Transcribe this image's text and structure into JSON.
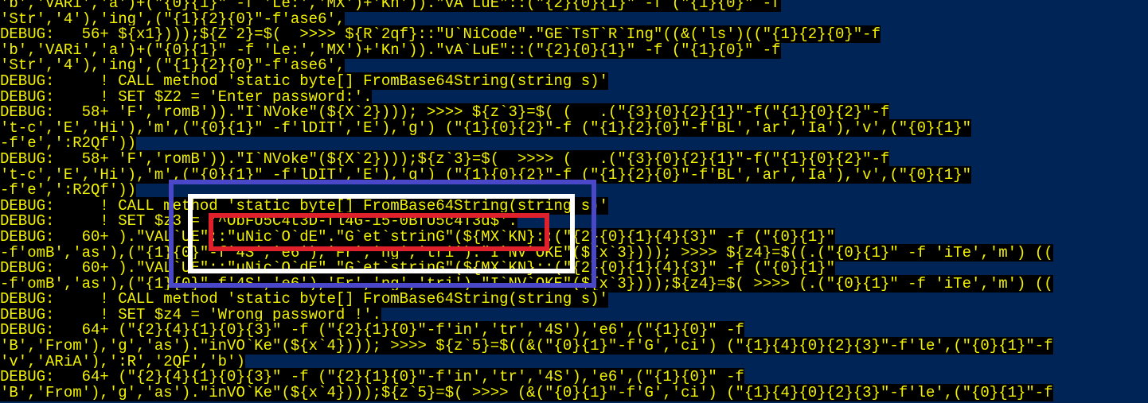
{
  "console": {
    "lines": [
      "'b','VARi','a')+(\"{0}{1}\" -f 'Le:','MX')+'Kn')).\"vA`LuE\"::(\"{2}{0}{1}\" -f (\"{1}{0}\" -f",
      "'Str','4'),'ing',(\"{1}{2}{0}\"-f'ase6',",
      "DEBUG:   56+ ${x1})));${Z`2}=$(  >>>> ${R`2qf}::\"U`NiCode\".\"GE`TsT`R`Ing\"((&('ls')((\"{1}{2}{0}\"-f",
      "'b','VARi','a')+(\"{0}{1}\" -f 'Le:','MX')+'Kn')).\"vA`LuE\"::(\"{2}{0}{1}\" -f (\"{1}{0}\" -f",
      "'Str','4'),'ing',(\"{1}{2}{0}\"-f'ase6',",
      "DEBUG:     ! CALL method 'static byte[] FromBase64String(string s)'",
      "DEBUG:     ! SET $Z2 = 'Enter password:'.",
      "DEBUG:   58+ 'F','romB')).\"I`NVoke\"(${X`2}))); >>>> ${z`3}=$( (   .(\"{3}{0}{2}{1}\"-f(\"{1}{0}{2}\"-f",
      "'t-c','E','Hi'),'m',(\"{0}{1}\" -f'lDIT','E'),'g') (\"{1}{0}{2}\"-f (\"{1}{2}{0}\"-f'BL','ar','Ia'),'v',(\"{0}{1}\"",
      "-f'e',':R2Qf'))",
      "DEBUG:   58+ 'F','romB')).\"I`NVoke\"(${X`2})));${z`3}=$(  >>>> (   .(\"{3}{0}{2}{1}\"-f(\"{1}{0}{2}\"-f",
      "'t-c','E','Hi'),'m',(\"{0}{1}\" -f'lDIT','E'),'g') (\"{1}{0}{2}\"-f (\"{1}{2}{0}\"-f'BL','ar','Ia'),'v',(\"{0}{1}\"",
      "-f'e',':R2Qf'))",
      "DEBUG:     ! CALL method 'static byte[] FromBase64String(string s)'",
      "DEBUG:     ! SET $z3 = '^ObFU5C4t3D-fl4G-i5-0BfU5c4T3d$'.",
      "DEBUG:   60+ ).\"VAL`UE\"::\"uNic`O`dE\".\"G`et`strinG\"(${MX`KN}::(\"{2}{0}{1}{4}{3}\" -f (\"{0}{1}\"",
      "-f'omB','as'),(\"{1}{0}\"-f'4S','e6'),'Fr','ng','tri').\"I`NV`OKE\"(${x`3}))); >>>> ${z4}=$((.(\"{0}{1}\" -f 'iTe','m') ((",
      "DEBUG:   60+ ).\"VAL`UE\"::\"uNic`O`dE\".\"G`et`strinG\"(${MX`KN}::(\"{2}{0}{1}{4}{3}\" -f (\"{0}{1}\"",
      "-f'omB','as'),(\"{1}{0}\"-f'4S','e6'),'Fr','ng','tri').\"I`NV`OKE\"(${x`3})));${z4}=$( >>>> (.(\"{0}{1}\" -f 'iTe','m') ((",
      "DEBUG:     ! CALL method 'static byte[] FromBase64String(string s)'",
      "DEBUG:     ! SET $z4 = 'Wrong password !'.",
      "DEBUG:   64+ (\"{2}{4}{1}{0}{3}\" -f (\"{2}{1}{0}\"-f'in','tr','4S'),'e6',(\"{1}{0}\" -f",
      "'B','From'),'g','as').\"inVO`Ke\"(${x`4}))); >>>> ${z`5}=$((&(\"{0}{1}\"-f'G','ci') (\"{1}{4}{0}{2}{3}\"-f'le',(\"{0}{1}\"-f",
      "'v','ARiA'),':R','2QF','b')",
      "DEBUG:   64+ (\"{2}{4}{1}{0}{3}\" -f (\"{2}{1}{0}\"-f'in','tr','4S'),'e6',(\"{1}{0}\" -f",
      "'B','From'),'g','as').\"inVO`Ke\"(${x`4})));${z`5}=$( >>>> (&(\"{0}{1}\"-f'G','ci') (\"{1}{4}{0}{2}{3}\"-f'le',(\"{0}{1}\"-f"
    ]
  },
  "colors": {
    "console_background": "#012456",
    "text_foreground": "#f2f200",
    "text_background": "#000000",
    "outer_box": "#4a48c8",
    "middle_box": "#ffffff",
    "inner_box": "#e0202a"
  }
}
